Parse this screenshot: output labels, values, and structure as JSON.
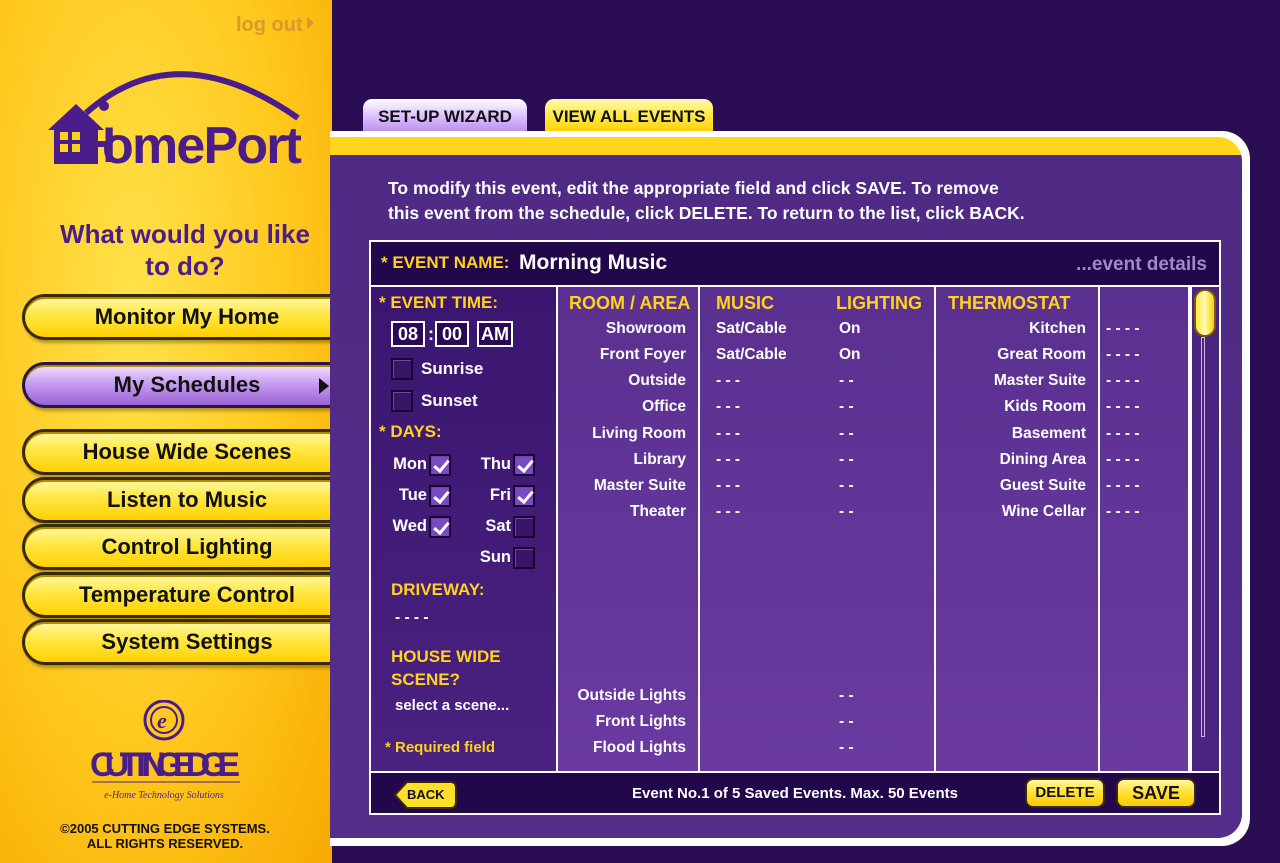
{
  "sidebar": {
    "logout": "log out",
    "logo_text": "HomePort",
    "question": "What would you like to do?",
    "nav": [
      {
        "label": "Monitor My Home"
      },
      {
        "label": "My Schedules"
      },
      {
        "label": "House Wide Scenes"
      },
      {
        "label": "Listen to Music"
      },
      {
        "label": "Control Lighting"
      },
      {
        "label": "Temperature Control"
      },
      {
        "label": "System Settings"
      }
    ],
    "company_logo": "CUTTINGEDGE",
    "company_tagline": "e-Home Technology Solutions",
    "copyright_line1": "©2005 CUTTING EDGE SYSTEMS.",
    "copyright_line2": "ALL RIGHTS RESERVED."
  },
  "tabs": [
    {
      "label": "SET-UP WIZARD"
    },
    {
      "label": "VIEW ALL EVENTS"
    }
  ],
  "instructions_line1": "To modify this event, edit the appropriate field and click SAVE. To remove",
  "instructions_line2": "this event from the schedule, click DELETE. To return to the list, click BACK.",
  "event": {
    "name_label": "* EVENT NAME:",
    "name_value": "Morning Music",
    "details_link": "...event details",
    "time_label": "* EVENT TIME:",
    "hour": "08",
    "minute": "00",
    "ampm": "AM",
    "sunrise": "Sunrise",
    "sunset": "Sunset",
    "days_label": "* DAYS:",
    "days": {
      "mon": "Mon",
      "tue": "Tue",
      "wed": "Wed",
      "thu": "Thu",
      "fri": "Fri",
      "sat": "Sat",
      "sun": "Sun"
    },
    "days_checked": [
      "Mon",
      "Tue",
      "Wed",
      "Thu",
      "Fri"
    ],
    "driveway_label": "DRIVEWAY:",
    "driveway_value": "- - - -",
    "scene_label_1": "HOUSE WIDE",
    "scene_label_2": "SCENE?",
    "scene_select": "select a scene...",
    "required": "* Required field"
  },
  "columns": {
    "room": "ROOM / AREA",
    "music": "MUSIC",
    "lighting": "LIGHTING",
    "thermostat": "THERMOSTAT"
  },
  "rooms": [
    {
      "room": "Showroom",
      "music": "Sat/Cable",
      "lighting": "On"
    },
    {
      "room": "Front Foyer",
      "music": "Sat/Cable",
      "lighting": "On"
    },
    {
      "room": "Outside",
      "music": "- - -",
      "lighting": "- -"
    },
    {
      "room": "Office",
      "music": "- - -",
      "lighting": "- -"
    },
    {
      "room": "Living Room",
      "music": "- - -",
      "lighting": "- -"
    },
    {
      "room": "Library",
      "music": "- - -",
      "lighting": "- -"
    },
    {
      "room": "Master Suite",
      "music": "- - -",
      "lighting": "- -"
    },
    {
      "room": "Theater",
      "music": "- - -",
      "lighting": "- -"
    }
  ],
  "lights": [
    {
      "name": "Outside Lights",
      "lighting": "- -"
    },
    {
      "name": "Front Lights",
      "lighting": "- -"
    },
    {
      "name": "Flood Lights",
      "lighting": "- -"
    }
  ],
  "thermostats": [
    {
      "zone": "Kitchen",
      "value": "- - - -"
    },
    {
      "zone": "Great Room",
      "value": "- - - -"
    },
    {
      "zone": "Master Suite",
      "value": "- - - -"
    },
    {
      "zone": "Kids Room",
      "value": "- - - -"
    },
    {
      "zone": "Basement",
      "value": "- - - -"
    },
    {
      "zone": "Dining Area",
      "value": "- - - -"
    },
    {
      "zone": "Guest Suite",
      "value": "- - - -"
    },
    {
      "zone": "Wine Cellar",
      "value": "- - - -"
    }
  ],
  "footer": {
    "back": "BACK",
    "status": "Event No.1 of 5 Saved Events. Max. 50 Events",
    "delete": "DELETE",
    "save": "SAVE"
  },
  "colors": {
    "accent_yellow": "#ffd21e",
    "panel_purple": "#552e8c",
    "dark_purple": "#22084a"
  }
}
